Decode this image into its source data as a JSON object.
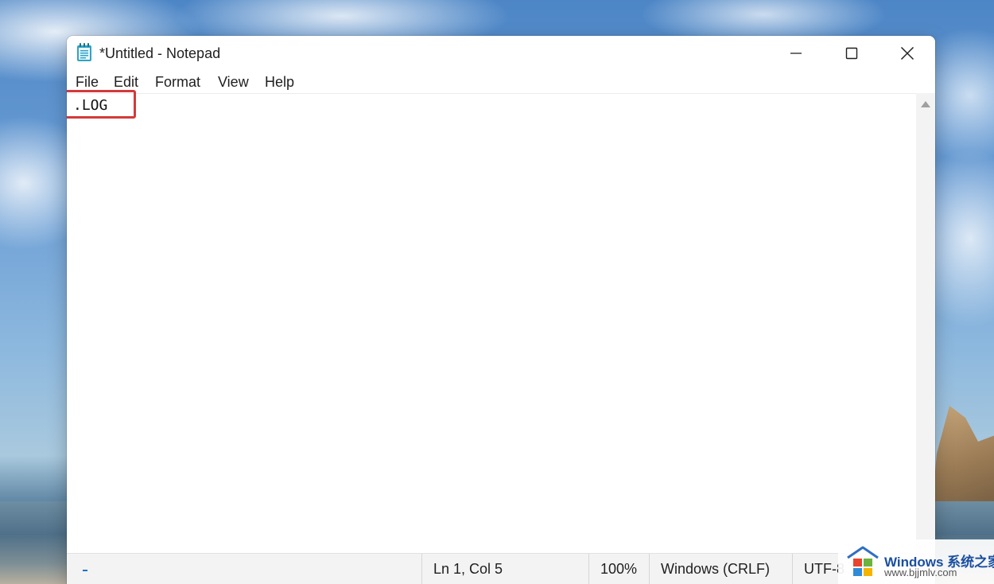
{
  "window": {
    "title": "*Untitled - Notepad"
  },
  "menu": {
    "items": [
      "File",
      "Edit",
      "Format",
      "View",
      "Help"
    ]
  },
  "editor": {
    "content": ".LOG"
  },
  "statusbar": {
    "position": "Ln 1, Col 5",
    "zoom": "100%",
    "line_ending": "Windows (CRLF)",
    "encoding": "UTF-8"
  },
  "watermark": {
    "brand": "Windows 系统之家",
    "url": "www.bjjmlv.com"
  },
  "colors": {
    "highlight_box": "#d23a3a",
    "icon_accent": "#2fa3c7"
  },
  "icons": {
    "app": "notepad-icon",
    "minimize": "minimize-icon",
    "maximize": "maximize-icon",
    "close": "close-icon"
  }
}
